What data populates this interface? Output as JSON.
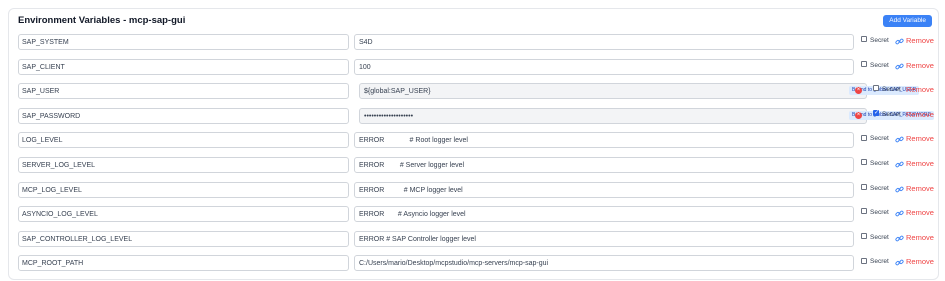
{
  "header": {
    "title": "Environment Variables - mcp-sap-gui",
    "add_button": "Add Variable"
  },
  "labels": {
    "secret": "Secret",
    "remove": "Remove"
  },
  "rows": [
    {
      "name": "SAP_SYSTEM",
      "value": "S4D",
      "secret": false,
      "bound": false
    },
    {
      "name": "SAP_CLIENT",
      "value": "100",
      "secret": false,
      "bound": false
    },
    {
      "name": "SAP_USER",
      "value": "${global:SAP_USER}",
      "secret": false,
      "bound": true,
      "badge": "Bound to global: SAP_USER"
    },
    {
      "name": "SAP_PASSWORD",
      "value": "••••••••••••••••••••",
      "secret": true,
      "bound": true,
      "badge": "Bound to global: SAP_PASSWORD"
    },
    {
      "name": "LOG_LEVEL",
      "value": "ERROR             # Root logger level",
      "secret": false,
      "bound": false
    },
    {
      "name": "SERVER_LOG_LEVEL",
      "value": "ERROR        # Server logger level",
      "secret": false,
      "bound": false
    },
    {
      "name": "MCP_LOG_LEVEL",
      "value": "ERROR          # MCP logger level",
      "secret": false,
      "bound": false
    },
    {
      "name": "ASYNCIO_LOG_LEVEL",
      "value": "ERROR       # Asyncio logger level",
      "secret": false,
      "bound": false
    },
    {
      "name": "SAP_CONTROLLER_LOG_LEVEL",
      "value": "ERROR # SAP Controller logger level",
      "secret": false,
      "bound": false
    },
    {
      "name": "MCP_ROOT_PATH",
      "value": "C:/Users/mario/Desktop/mcpstudio/mcp-servers/mcp-sap-gui",
      "secret": false,
      "bound": false
    }
  ]
}
